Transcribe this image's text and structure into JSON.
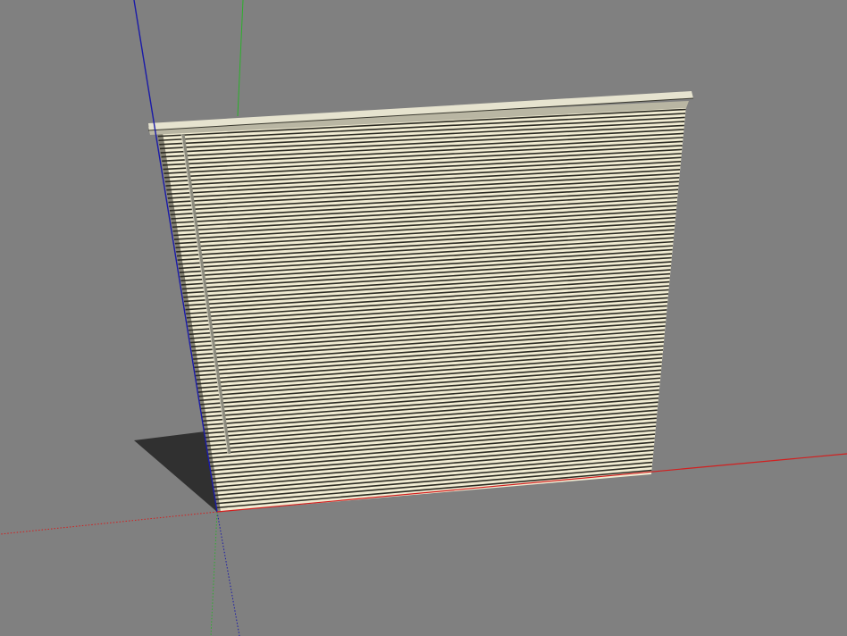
{
  "viewport": {
    "background": "#808080"
  },
  "axes": {
    "x_color": "#d21f1f",
    "y_color": "#2bb02b",
    "z_color": "#1a1aa8"
  },
  "model": {
    "type": "venetian-blind",
    "slat_light": "#f0ebd2",
    "slat_dark": "#2b2a22",
    "headrail": "#e6e3cf",
    "wand": "#8c8b7e",
    "shadow": "#303030"
  }
}
